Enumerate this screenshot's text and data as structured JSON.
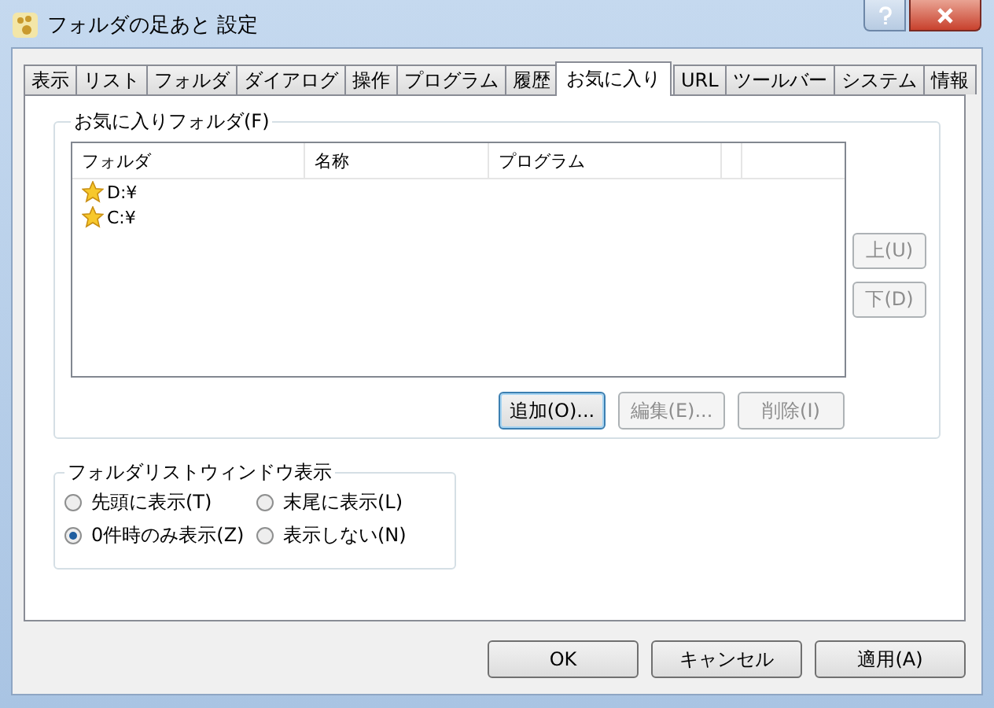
{
  "window": {
    "title": "フォルダの足あと 設定"
  },
  "tabs": [
    {
      "label": "表示",
      "selected": false
    },
    {
      "label": "リスト",
      "selected": false
    },
    {
      "label": "フォルダ",
      "selected": false
    },
    {
      "label": "ダイアログ",
      "selected": false
    },
    {
      "label": "操作",
      "selected": false
    },
    {
      "label": "プログラム",
      "selected": false
    },
    {
      "label": "履歴",
      "selected": false
    },
    {
      "label": "お気に入り",
      "selected": true
    },
    {
      "label": "URL",
      "selected": false
    },
    {
      "label": "ツールバー",
      "selected": false
    },
    {
      "label": "システム",
      "selected": false
    },
    {
      "label": "情報",
      "selected": false
    }
  ],
  "favorites": {
    "title": "お気に入りフォルダ(F)",
    "columns": [
      "フォルダ",
      "名称",
      "プログラム"
    ],
    "rows": [
      {
        "folder": "D:¥"
      },
      {
        "folder": "C:¥"
      }
    ],
    "side_buttons": [
      {
        "label": "上(U)",
        "disabled": true
      },
      {
        "label": "下(D)",
        "disabled": true
      }
    ],
    "buttons": [
      {
        "label": "追加(O)...",
        "disabled": false
      },
      {
        "label": "編集(E)...",
        "disabled": true
      },
      {
        "label": "削除(I)",
        "disabled": true
      }
    ]
  },
  "folder_list_window": {
    "title": "フォルダリストウィンドウ表示",
    "options": [
      {
        "label": "先頭に表示(T)",
        "selected": false
      },
      {
        "label": "末尾に表示(L)",
        "selected": false
      },
      {
        "label": "0件時のみ表示(Z)",
        "selected": true
      },
      {
        "label": "表示しない(N)",
        "selected": false
      }
    ]
  },
  "buttons": [
    {
      "label": "OK"
    },
    {
      "label": "キャンセル"
    },
    {
      "label": "適用(A)"
    }
  ]
}
